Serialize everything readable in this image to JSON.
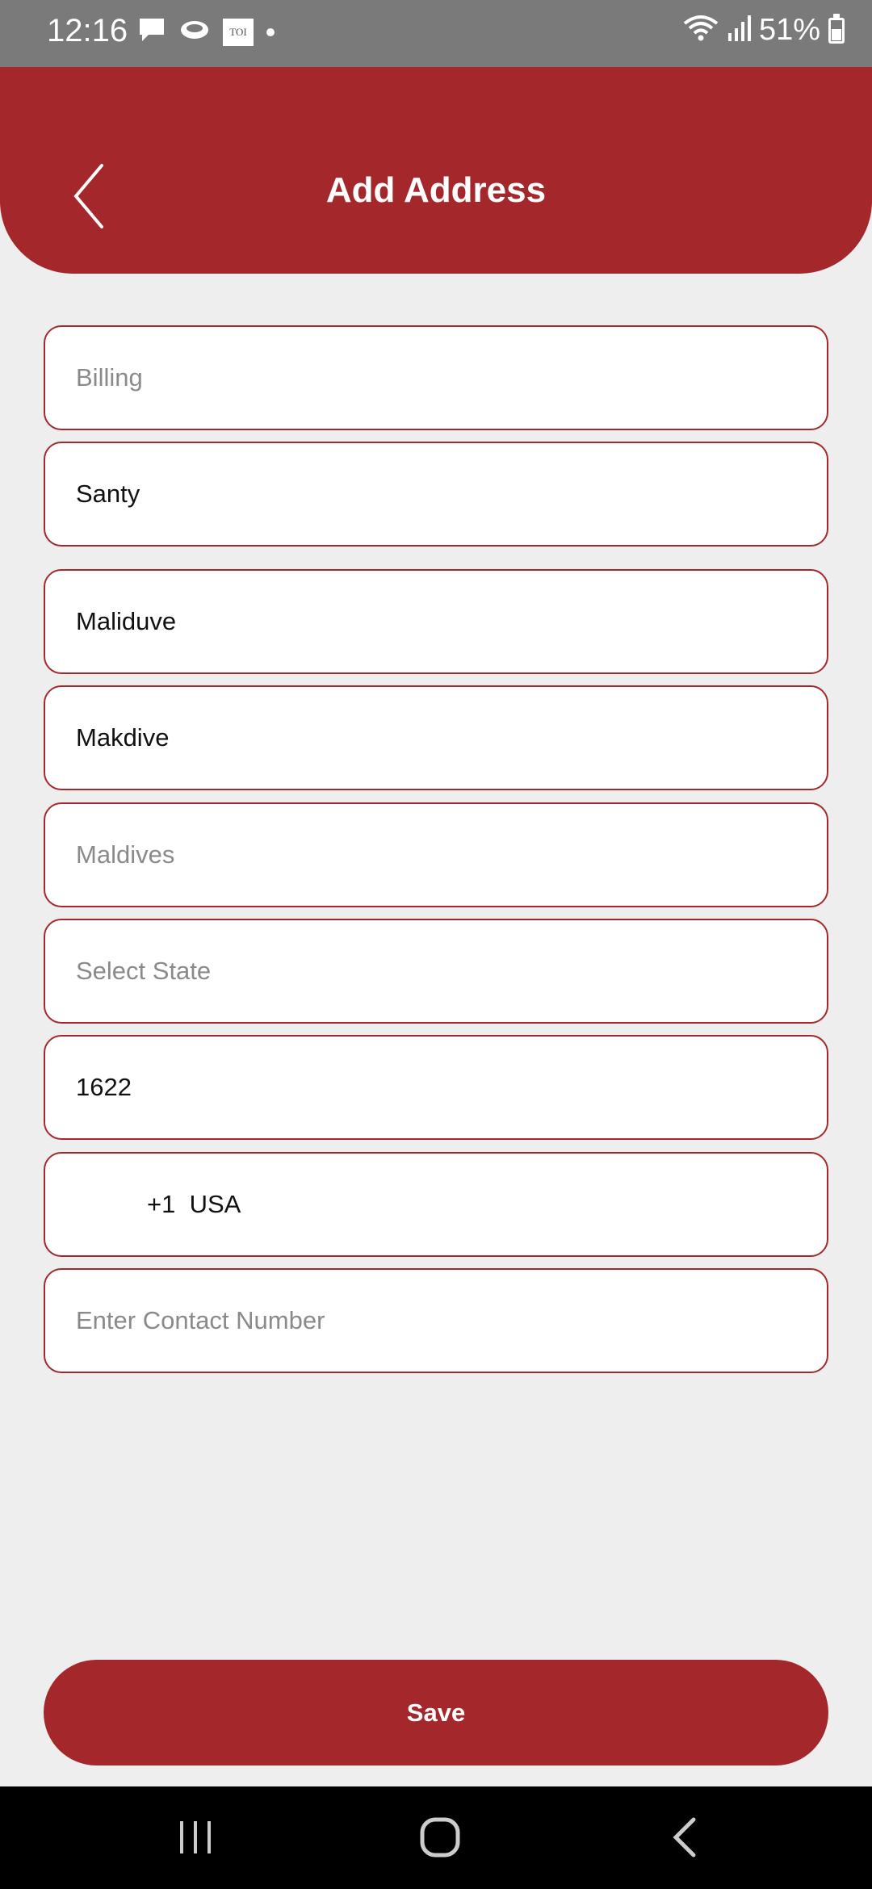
{
  "status_bar": {
    "time": "12:16",
    "battery": "51%",
    "toi_label": "TOI",
    "icons_left": [
      "message-icon",
      "cloud-icon",
      "toi-icon",
      "dot-icon"
    ],
    "icons_right": [
      "wifi-icon",
      "signal-icon",
      "battery-icon"
    ],
    "battery_level": 0.51
  },
  "header": {
    "title": "Add Address",
    "back_icon": "chevron-left-icon",
    "color": "#a4282b"
  },
  "form": {
    "fields": [
      {
        "name": "address-type-field",
        "text": "Billing",
        "is_placeholder": true
      },
      {
        "name": "name-field",
        "text": "Santy",
        "is_placeholder": false
      },
      {
        "name": "address-line-field",
        "text": "Maliduve",
        "is_placeholder": false
      },
      {
        "name": "city-field",
        "text": "Makdive",
        "is_placeholder": false
      },
      {
        "name": "country-field",
        "text": "Maldives",
        "is_placeholder": true
      },
      {
        "name": "state-select",
        "text": "Select State",
        "is_placeholder": true
      },
      {
        "name": "zip-field",
        "text": "1622",
        "is_placeholder": false
      },
      {
        "name": "country-code-select",
        "text": "+1  USA",
        "is_placeholder": false
      },
      {
        "name": "contact-number-input",
        "text": "Enter Contact Number",
        "is_placeholder": true
      }
    ]
  },
  "save_button": {
    "label": "Save"
  },
  "nav_bar": {
    "icons": [
      "recent-apps-icon",
      "home-icon",
      "back-icon"
    ]
  }
}
